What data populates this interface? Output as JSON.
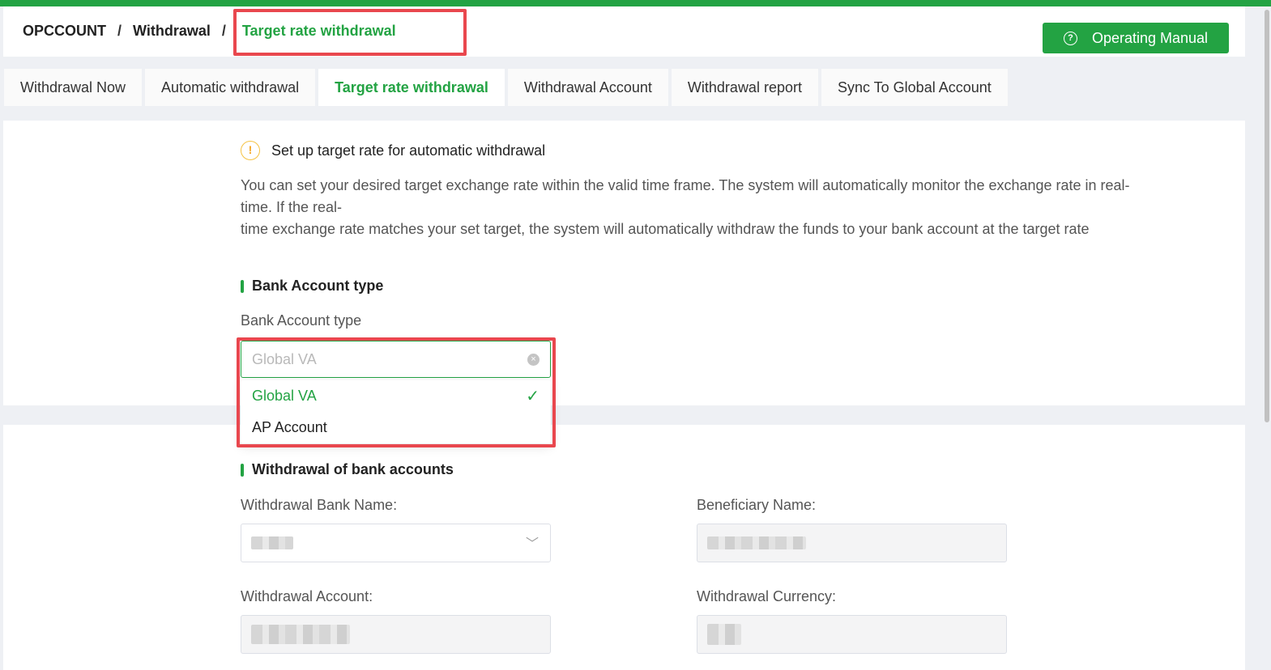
{
  "breadcrumb": {
    "root": "OPCCOUNT",
    "section": "Withdrawal",
    "current": "Target rate withdrawal",
    "separator": "/"
  },
  "header": {
    "manual_button": "Operating Manual"
  },
  "tabs": [
    {
      "label": "Withdrawal Now"
    },
    {
      "label": "Automatic withdrawal"
    },
    {
      "label": "Target rate withdrawal",
      "active": true
    },
    {
      "label": "Withdrawal Account"
    },
    {
      "label": "Withdrawal report"
    },
    {
      "label": "Sync To Global Account"
    }
  ],
  "notice": {
    "title": "Set up target rate for automatic withdrawal",
    "line1": "You can set your desired target exchange rate within the valid time frame. The system will automatically monitor the exchange rate in real-time. If the real-",
    "line2": "time exchange rate matches your set target, the system will automatically withdraw the funds to your bank account at the target rate"
  },
  "bank_section": {
    "title": "Bank Account type",
    "field_label": "Bank Account type",
    "placeholder": "Global VA",
    "options": [
      {
        "label": "Global VA",
        "selected": true
      },
      {
        "label": "AP Account",
        "selected": false
      }
    ]
  },
  "withdrawal_section": {
    "title": "Withdrawal of bank accounts",
    "bank_name_label": "Withdrawal Bank Name:",
    "beneficiary_label": "Beneficiary Name:",
    "account_label": "Withdrawal Account:",
    "currency_label": "Withdrawal Currency:"
  },
  "colors": {
    "brand": "#23a343",
    "highlight": "#e9474e"
  },
  "icons": {
    "manual": "question-circle-icon",
    "notice": "warning-icon",
    "clear": "clear-icon",
    "check": "check-icon",
    "dropdown": "chevron-down-icon"
  }
}
